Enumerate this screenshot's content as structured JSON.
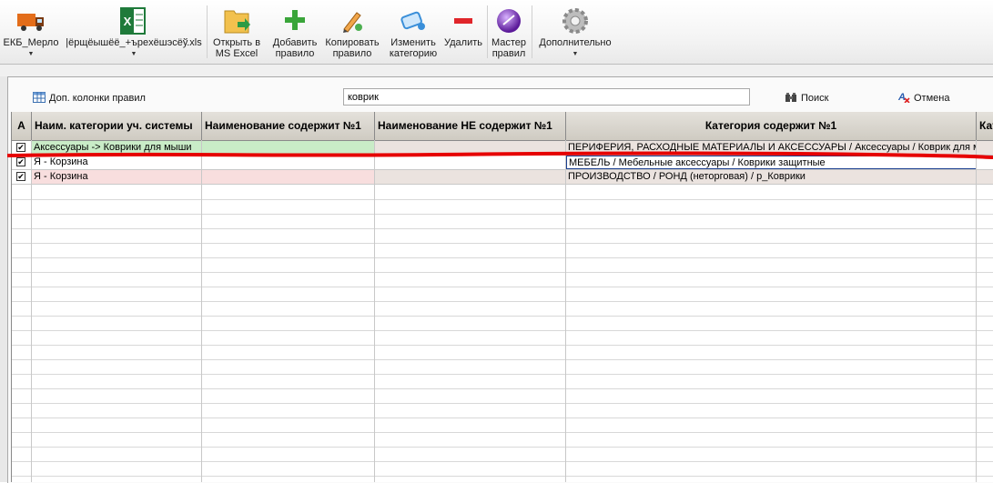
{
  "toolbar": {
    "buttons": [
      {
        "label": "ЕКБ_Мерло",
        "icon": "truck-icon",
        "dropdown": true
      },
      {
        "label": "|ёрщёышёё_+ъреxёшэсёў.xls",
        "icon": "excel-icon",
        "dropdown": true
      },
      {
        "label": "Открыть в\nMS Excel",
        "icon": "folder-excel-icon"
      },
      {
        "label": "Добавить\nправило",
        "icon": "plus-icon"
      },
      {
        "label": "Копировать\nправило",
        "icon": "pencil-icon"
      },
      {
        "label": "Изменить\nкатегорию",
        "icon": "edit-category-icon"
      },
      {
        "label": "Удалить",
        "icon": "minus-icon"
      },
      {
        "label": "Мастер\nправил",
        "icon": "wizard-orb-icon"
      },
      {
        "label": "Дополнительно",
        "icon": "gear-icon",
        "dropdown": true
      }
    ]
  },
  "filterbar": {
    "extra_columns_label": "Доп. колонки правил",
    "search_value": "коврик",
    "search_label": "Поиск",
    "cancel_label": "Отмена"
  },
  "grid": {
    "columns": [
      "А",
      "Наим. категории уч. системы",
      "Наименование содержит №1",
      "Наименование НЕ содержит №1",
      "Категория содержит №1",
      "Кат"
    ],
    "rows": [
      {
        "checked": true,
        "category": "Аксессуары -> Коврики для мыши",
        "contains": "",
        "not_contains": "",
        "cat_contains": "ПЕРИФЕРИЯ, РАСХОДНЫЕ МАТЕРИАЛЫ И АКСЕССУАРЫ / Аксессуары / Коврик для мыши",
        "color": "#c9ecc7"
      },
      {
        "checked": true,
        "category": "Я - Корзина",
        "contains": "",
        "not_contains": "",
        "cat_contains": "МЕБЕЛЬ / Мебельные аксессуары / Коврики защитные",
        "color": "#ffffff"
      },
      {
        "checked": true,
        "category": "Я - Корзина",
        "contains": "",
        "not_contains": "",
        "cat_contains": "ПРОИЗВОДСТВО / РОНД (неторговая) / р_Коврики",
        "color": "#f8dede"
      }
    ]
  },
  "colors": {
    "annotation_line": "#e60000",
    "header_bg": "#d4d0c8",
    "grid_line": "#c8c8c8"
  }
}
